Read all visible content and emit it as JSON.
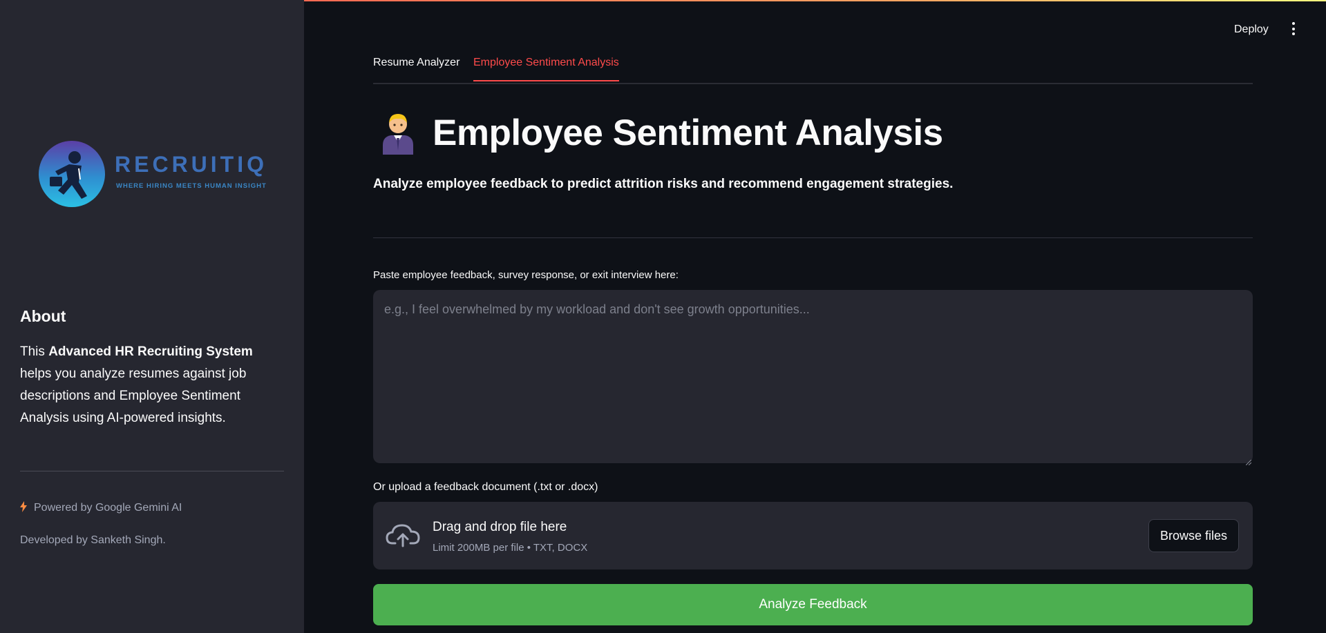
{
  "sidebar": {
    "logo": {
      "title": "RECRUITIQ",
      "tagline": "WHERE HIRING MEETS HUMAN INSIGHT"
    },
    "about": {
      "title": "About",
      "text_prefix": "This ",
      "text_bold": "Advanced HR Recruiting System",
      "text_suffix": " helps you analyze resumes against job descriptions and Employee Sentiment Analysis using AI-powered insights."
    },
    "powered_by": "Powered by Google Gemini AI",
    "developed_by": "Developed by Sanketh Singh."
  },
  "header": {
    "deploy_label": "Deploy"
  },
  "tabs": [
    {
      "label": "Resume Analyzer",
      "active": false
    },
    {
      "label": "Employee Sentiment Analysis",
      "active": true
    }
  ],
  "main": {
    "title": "Employee Sentiment Analysis",
    "subtitle": "Analyze employee feedback to predict attrition risks and recommend engagement strategies.",
    "feedback": {
      "label": "Paste employee feedback, survey response, or exit interview here:",
      "placeholder": "e.g., I feel overwhelmed by my workload and don't see growth opportunities...",
      "value": ""
    },
    "upload": {
      "label": "Or upload a feedback document (.txt or .docx)",
      "drop_title": "Drag and drop file here",
      "limit_text": "Limit 200MB per file • TXT, DOCX",
      "browse_label": "Browse files"
    },
    "analyze_label": "Analyze Feedback"
  },
  "colors": {
    "accent": "#ff4b4b",
    "primary_button": "#4caf50",
    "background": "#0e1117",
    "sidebar": "#262730"
  }
}
